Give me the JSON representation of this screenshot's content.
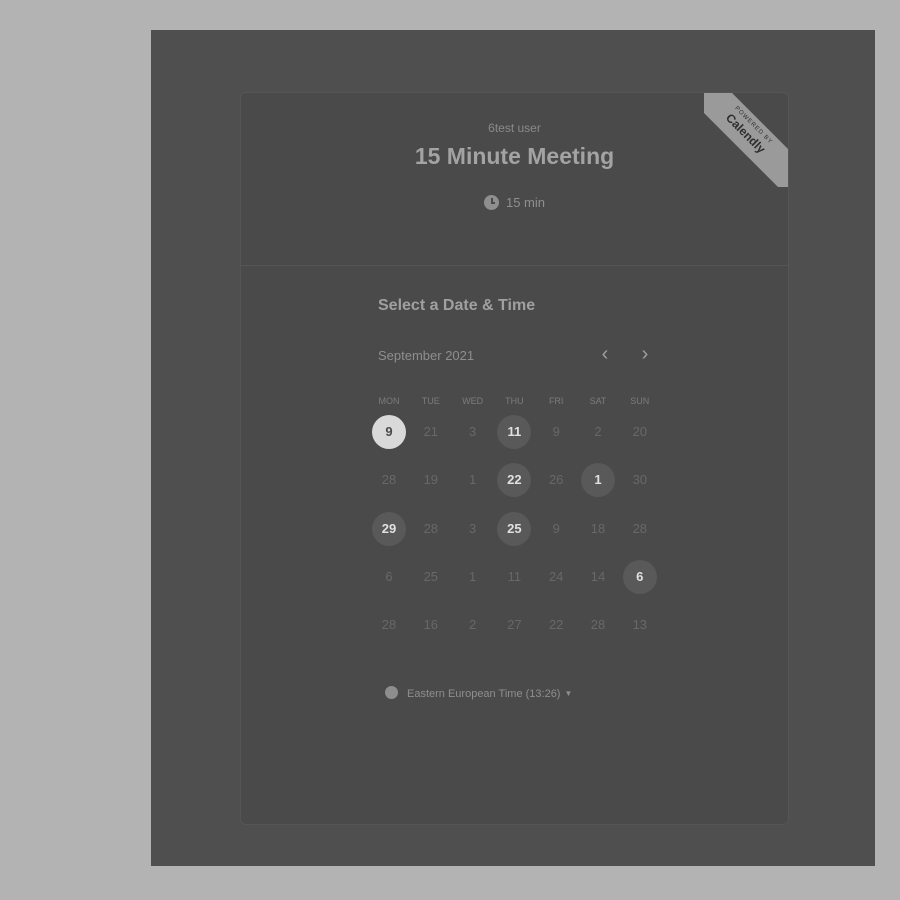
{
  "ribbon": {
    "small": "POWERED BY",
    "brand": "Calendly"
  },
  "event": {
    "owner": "6test user",
    "title": "15 Minute Meeting",
    "duration": "15 min"
  },
  "calendar": {
    "heading": "Select a Date & Time",
    "month": "September 2021",
    "prev_label": "‹",
    "next_label": "›",
    "weekdays": [
      "MON",
      "TUE",
      "WED",
      "THU",
      "FRI",
      "SAT",
      "SUN"
    ],
    "weeks": [
      [
        {
          "label": "9",
          "state": "selected"
        },
        {
          "label": "21",
          "state": "unavailable"
        },
        {
          "label": "3",
          "state": "unavailable"
        },
        {
          "label": "11",
          "state": "available"
        },
        {
          "label": "9",
          "state": "unavailable"
        },
        {
          "label": "2",
          "state": "unavailable"
        },
        {
          "label": "20",
          "state": "unavailable"
        }
      ],
      [
        {
          "label": "28",
          "state": "unavailable"
        },
        {
          "label": "19",
          "state": "unavailable"
        },
        {
          "label": "1",
          "state": "unavailable"
        },
        {
          "label": "22",
          "state": "available"
        },
        {
          "label": "26",
          "state": "unavailable"
        },
        {
          "label": "1",
          "state": "available"
        },
        {
          "label": "30",
          "state": "unavailable"
        }
      ],
      [
        {
          "label": "29",
          "state": "available"
        },
        {
          "label": "28",
          "state": "unavailable"
        },
        {
          "label": "3",
          "state": "unavailable"
        },
        {
          "label": "25",
          "state": "available"
        },
        {
          "label": "9",
          "state": "unavailable"
        },
        {
          "label": "18",
          "state": "unavailable"
        },
        {
          "label": "28",
          "state": "unavailable"
        }
      ],
      [
        {
          "label": "6",
          "state": "unavailable"
        },
        {
          "label": "25",
          "state": "unavailable"
        },
        {
          "label": "1",
          "state": "unavailable"
        },
        {
          "label": "11",
          "state": "unavailable"
        },
        {
          "label": "24",
          "state": "unavailable"
        },
        {
          "label": "14",
          "state": "unavailable"
        },
        {
          "label": "6",
          "state": "available"
        }
      ],
      [
        {
          "label": "28",
          "state": "unavailable"
        },
        {
          "label": "16",
          "state": "unavailable"
        },
        {
          "label": "2",
          "state": "unavailable"
        },
        {
          "label": "27",
          "state": "unavailable"
        },
        {
          "label": "22",
          "state": "unavailable"
        },
        {
          "label": "28",
          "state": "unavailable"
        },
        {
          "label": "13",
          "state": "unavailable"
        }
      ]
    ]
  },
  "timezone": {
    "label": "Eastern European Time (13:26)"
  },
  "icons": {
    "duration": "clock-icon",
    "timezone": "globe-icon",
    "prev": "chevron-left-icon",
    "next": "chevron-right-icon",
    "dropdown": "caret-down-icon"
  }
}
